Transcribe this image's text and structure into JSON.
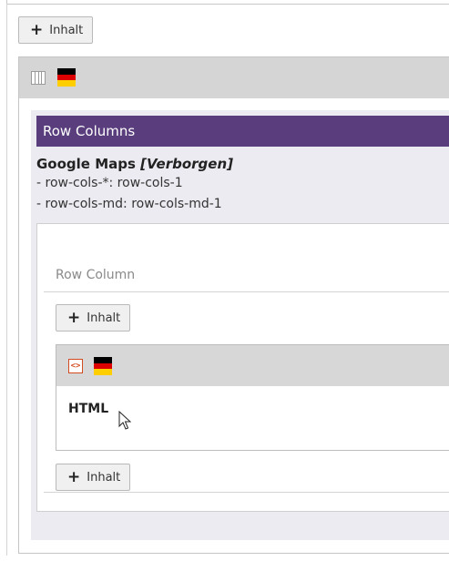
{
  "top_button": {
    "label": "Inhalt"
  },
  "row_element": {
    "flag": "de-flag-icon",
    "banner_title": "Row Columns",
    "content_title": "Google Maps",
    "content_status": "[Verborgen]",
    "props": [
      "- row-cols-*: row-cols-1",
      "- row-cols-md: row-cols-md-1"
    ]
  },
  "column": {
    "label": "Row Column",
    "add_button": "Inhalt",
    "add_button_bottom": "Inhalt"
  },
  "html_card": {
    "icon": "html-code-icon",
    "label": "HTML"
  },
  "colors": {
    "purple": "#593d7d",
    "header_grey": "#d5d5d5",
    "panel_bg": "#ecebf1",
    "html_icon": "#d44a20"
  }
}
